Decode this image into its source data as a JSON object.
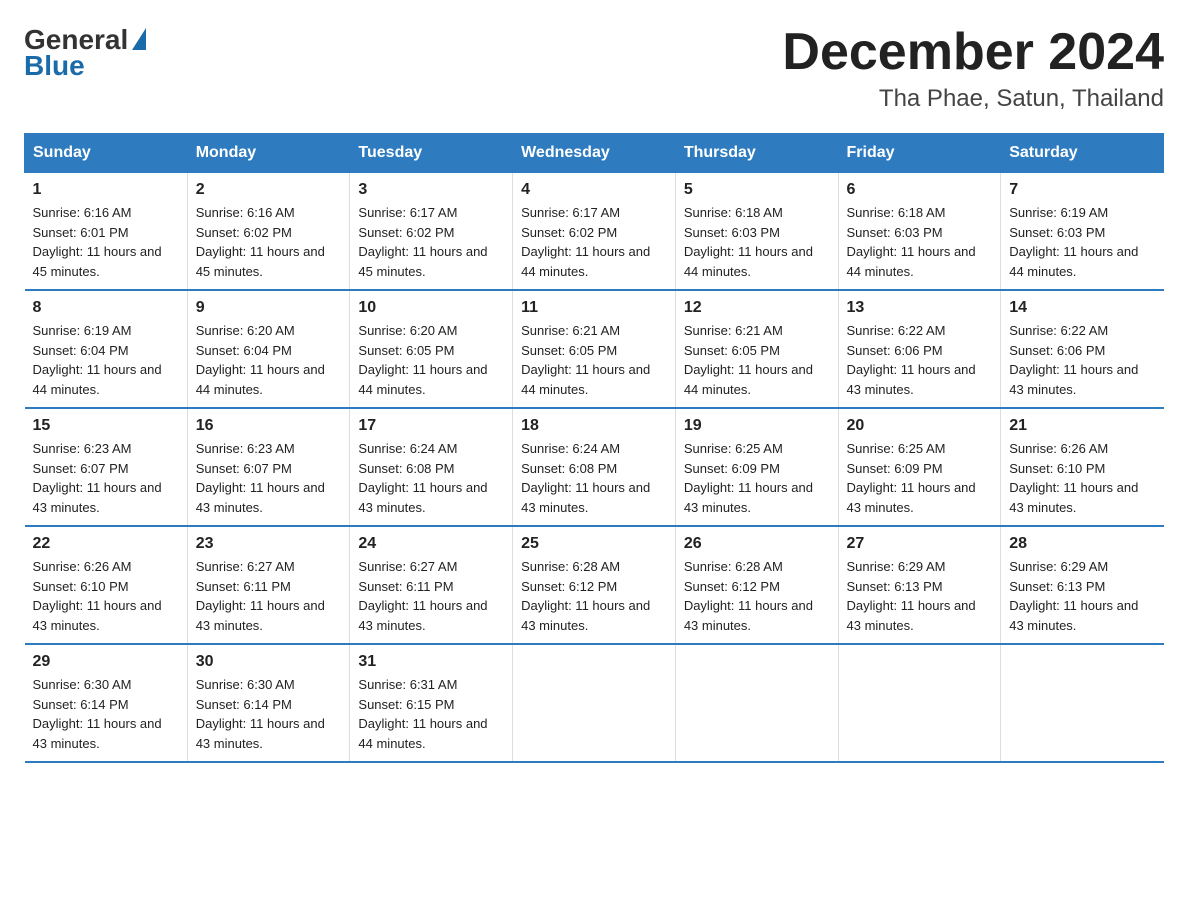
{
  "logo": {
    "general": "General",
    "blue": "Blue"
  },
  "title": {
    "month_year": "December 2024",
    "location": "Tha Phae, Satun, Thailand"
  },
  "headers": [
    "Sunday",
    "Monday",
    "Tuesday",
    "Wednesday",
    "Thursday",
    "Friday",
    "Saturday"
  ],
  "weeks": [
    [
      {
        "day": "1",
        "sunrise": "6:16 AM",
        "sunset": "6:01 PM",
        "daylight": "11 hours and 45 minutes."
      },
      {
        "day": "2",
        "sunrise": "6:16 AM",
        "sunset": "6:02 PM",
        "daylight": "11 hours and 45 minutes."
      },
      {
        "day": "3",
        "sunrise": "6:17 AM",
        "sunset": "6:02 PM",
        "daylight": "11 hours and 45 minutes."
      },
      {
        "day": "4",
        "sunrise": "6:17 AM",
        "sunset": "6:02 PM",
        "daylight": "11 hours and 44 minutes."
      },
      {
        "day": "5",
        "sunrise": "6:18 AM",
        "sunset": "6:03 PM",
        "daylight": "11 hours and 44 minutes."
      },
      {
        "day": "6",
        "sunrise": "6:18 AM",
        "sunset": "6:03 PM",
        "daylight": "11 hours and 44 minutes."
      },
      {
        "day": "7",
        "sunrise": "6:19 AM",
        "sunset": "6:03 PM",
        "daylight": "11 hours and 44 minutes."
      }
    ],
    [
      {
        "day": "8",
        "sunrise": "6:19 AM",
        "sunset": "6:04 PM",
        "daylight": "11 hours and 44 minutes."
      },
      {
        "day": "9",
        "sunrise": "6:20 AM",
        "sunset": "6:04 PM",
        "daylight": "11 hours and 44 minutes."
      },
      {
        "day": "10",
        "sunrise": "6:20 AM",
        "sunset": "6:05 PM",
        "daylight": "11 hours and 44 minutes."
      },
      {
        "day": "11",
        "sunrise": "6:21 AM",
        "sunset": "6:05 PM",
        "daylight": "11 hours and 44 minutes."
      },
      {
        "day": "12",
        "sunrise": "6:21 AM",
        "sunset": "6:05 PM",
        "daylight": "11 hours and 44 minutes."
      },
      {
        "day": "13",
        "sunrise": "6:22 AM",
        "sunset": "6:06 PM",
        "daylight": "11 hours and 43 minutes."
      },
      {
        "day": "14",
        "sunrise": "6:22 AM",
        "sunset": "6:06 PM",
        "daylight": "11 hours and 43 minutes."
      }
    ],
    [
      {
        "day": "15",
        "sunrise": "6:23 AM",
        "sunset": "6:07 PM",
        "daylight": "11 hours and 43 minutes."
      },
      {
        "day": "16",
        "sunrise": "6:23 AM",
        "sunset": "6:07 PM",
        "daylight": "11 hours and 43 minutes."
      },
      {
        "day": "17",
        "sunrise": "6:24 AM",
        "sunset": "6:08 PM",
        "daylight": "11 hours and 43 minutes."
      },
      {
        "day": "18",
        "sunrise": "6:24 AM",
        "sunset": "6:08 PM",
        "daylight": "11 hours and 43 minutes."
      },
      {
        "day": "19",
        "sunrise": "6:25 AM",
        "sunset": "6:09 PM",
        "daylight": "11 hours and 43 minutes."
      },
      {
        "day": "20",
        "sunrise": "6:25 AM",
        "sunset": "6:09 PM",
        "daylight": "11 hours and 43 minutes."
      },
      {
        "day": "21",
        "sunrise": "6:26 AM",
        "sunset": "6:10 PM",
        "daylight": "11 hours and 43 minutes."
      }
    ],
    [
      {
        "day": "22",
        "sunrise": "6:26 AM",
        "sunset": "6:10 PM",
        "daylight": "11 hours and 43 minutes."
      },
      {
        "day": "23",
        "sunrise": "6:27 AM",
        "sunset": "6:11 PM",
        "daylight": "11 hours and 43 minutes."
      },
      {
        "day": "24",
        "sunrise": "6:27 AM",
        "sunset": "6:11 PM",
        "daylight": "11 hours and 43 minutes."
      },
      {
        "day": "25",
        "sunrise": "6:28 AM",
        "sunset": "6:12 PM",
        "daylight": "11 hours and 43 minutes."
      },
      {
        "day": "26",
        "sunrise": "6:28 AM",
        "sunset": "6:12 PM",
        "daylight": "11 hours and 43 minutes."
      },
      {
        "day": "27",
        "sunrise": "6:29 AM",
        "sunset": "6:13 PM",
        "daylight": "11 hours and 43 minutes."
      },
      {
        "day": "28",
        "sunrise": "6:29 AM",
        "sunset": "6:13 PM",
        "daylight": "11 hours and 43 minutes."
      }
    ],
    [
      {
        "day": "29",
        "sunrise": "6:30 AM",
        "sunset": "6:14 PM",
        "daylight": "11 hours and 43 minutes."
      },
      {
        "day": "30",
        "sunrise": "6:30 AM",
        "sunset": "6:14 PM",
        "daylight": "11 hours and 43 minutes."
      },
      {
        "day": "31",
        "sunrise": "6:31 AM",
        "sunset": "6:15 PM",
        "daylight": "11 hours and 44 minutes."
      },
      null,
      null,
      null,
      null
    ]
  ]
}
